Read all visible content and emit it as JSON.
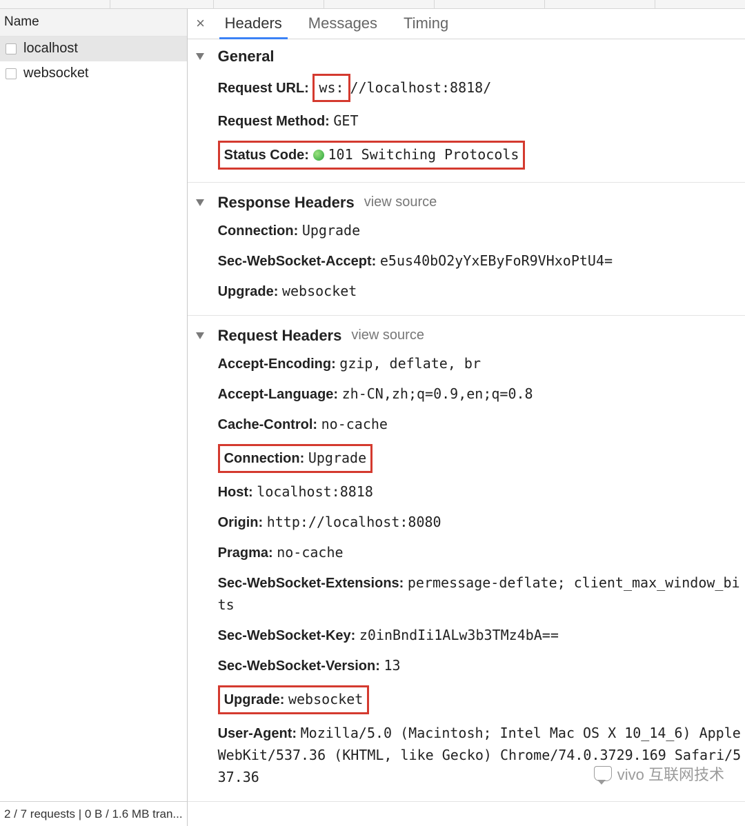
{
  "sidebar": {
    "header": "Name",
    "items": [
      {
        "label": "localhost",
        "selected": true
      },
      {
        "label": "websocket",
        "selected": false
      }
    ],
    "footer": "2 / 7 requests | 0 B / 1.6 MB tran..."
  },
  "tabs": {
    "close": "×",
    "items": [
      "Headers",
      "Messages",
      "Timing"
    ],
    "activeIndex": 0
  },
  "general": {
    "title": "General",
    "request_url_label": "Request URL:",
    "request_url_scheme": "ws:",
    "request_url_rest": "//localhost:8818/",
    "request_method_label": "Request Method:",
    "request_method_value": "GET",
    "status_code_label": "Status Code:",
    "status_code_value": "101 Switching Protocols"
  },
  "response_headers": {
    "title": "Response Headers",
    "view_source": "view source",
    "items": [
      {
        "k": "Connection:",
        "v": "Upgrade"
      },
      {
        "k": "Sec-WebSocket-Accept:",
        "v": "e5us40bO2yYxEByFoR9VHxoPtU4="
      },
      {
        "k": "Upgrade:",
        "v": "websocket"
      }
    ]
  },
  "request_headers": {
    "title": "Request Headers",
    "view_source": "view source",
    "accept_encoding_k": "Accept-Encoding:",
    "accept_encoding_v": "gzip, deflate, br",
    "accept_language_k": "Accept-Language:",
    "accept_language_v": "zh-CN,zh;q=0.9,en;q=0.8",
    "cache_control_k": "Cache-Control:",
    "cache_control_v": "no-cache",
    "connection_k": "Connection:",
    "connection_v": "Upgrade",
    "host_k": "Host:",
    "host_v": "localhost:8818",
    "origin_k": "Origin:",
    "origin_v": "http://localhost:8080",
    "pragma_k": "Pragma:",
    "pragma_v": "no-cache",
    "sw_ext_k": "Sec-WebSocket-Extensions:",
    "sw_ext_v": "permessage-deflate; client_max_window_bits",
    "sw_key_k": "Sec-WebSocket-Key:",
    "sw_key_v": "z0inBndIi1ALw3b3TMz4bA==",
    "sw_ver_k": "Sec-WebSocket-Version:",
    "sw_ver_v": "13",
    "upgrade_k": "Upgrade:",
    "upgrade_v": "websocket",
    "ua_k": "User-Agent:",
    "ua_v": "Mozilla/5.0 (Macintosh; Intel Mac OS X 10_14_6) AppleWebKit/537.36 (KHTML, like Gecko) Chrome/74.0.3729.169 Safari/537.36"
  },
  "watermark": "vivo 互联网技术"
}
